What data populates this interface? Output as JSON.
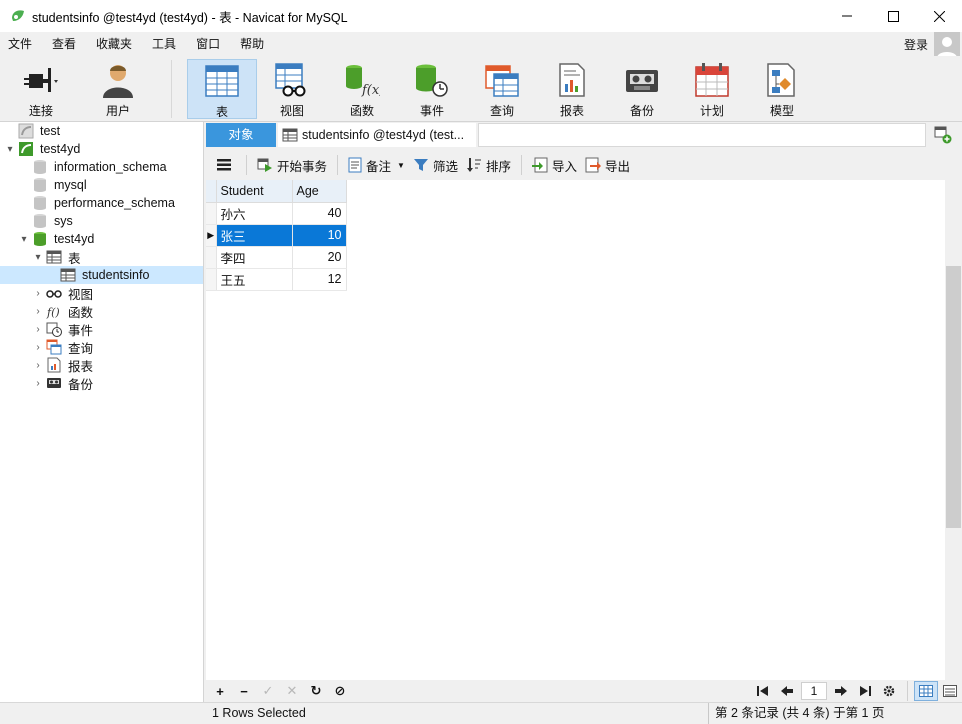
{
  "window": {
    "title": "studentsinfo @test4yd (test4yd) - 表 - Navicat for MySQL",
    "minimize": "minimize",
    "maximize": "maximize",
    "close": "close"
  },
  "menu": {
    "items": [
      "文件",
      "查看",
      "收藏夹",
      "工具",
      "窗口",
      "帮助"
    ],
    "login": "登录"
  },
  "toolbar": {
    "buttons": [
      {
        "label": "连接",
        "icon": "plug-icon"
      },
      {
        "label": "用户",
        "icon": "user-icon"
      },
      {
        "label": "表",
        "icon": "table-icon",
        "active": true
      },
      {
        "label": "视图",
        "icon": "view-icon"
      },
      {
        "label": "函数",
        "icon": "function-icon"
      },
      {
        "label": "事件",
        "icon": "event-icon"
      },
      {
        "label": "查询",
        "icon": "query-icon"
      },
      {
        "label": "报表",
        "icon": "report-icon"
      },
      {
        "label": "备份",
        "icon": "backup-icon"
      },
      {
        "label": "计划",
        "icon": "schedule-icon"
      },
      {
        "label": "模型",
        "icon": "model-icon"
      }
    ]
  },
  "sidebar": {
    "nodes": [
      {
        "label": "test",
        "icon": "connection-icon-inactive",
        "expanded": null
      },
      {
        "label": "test4yd",
        "icon": "connection-icon-active",
        "expanded": true
      },
      {
        "label": "information_schema",
        "icon": "database-icon-inactive"
      },
      {
        "label": "mysql",
        "icon": "database-icon-inactive"
      },
      {
        "label": "performance_schema",
        "icon": "database-icon-inactive"
      },
      {
        "label": "sys",
        "icon": "database-icon-inactive"
      },
      {
        "label": "test4yd",
        "icon": "database-icon-active",
        "expanded": true
      },
      {
        "label": "表",
        "icon": "table-icon",
        "expanded": true
      },
      {
        "label": "studentsinfo",
        "icon": "table-icon",
        "selected": true
      },
      {
        "label": "视图",
        "icon": "view-icon",
        "expanded": false
      },
      {
        "label": "函数",
        "icon": "function-icon",
        "expanded": false
      },
      {
        "label": "事件",
        "icon": "event-icon",
        "expanded": false
      },
      {
        "label": "查询",
        "icon": "query-icon",
        "expanded": false
      },
      {
        "label": "报表",
        "icon": "report-icon",
        "expanded": false
      },
      {
        "label": "备份",
        "icon": "backup-icon",
        "expanded": false
      }
    ]
  },
  "tabs": {
    "objects": "对象",
    "document": "studentsinfo @test4yd (test..."
  },
  "table_toolbar": {
    "menu_icon": "hamburger-icon",
    "begin_transaction": "开始事务",
    "memo": "备注",
    "filter": "筛选",
    "sort": "排序",
    "import": "导入",
    "export": "导出"
  },
  "grid": {
    "columns": [
      "Student",
      "Age"
    ],
    "rows": [
      {
        "Student": "孙六",
        "Age": "40"
      },
      {
        "Student": "张三",
        "Age": "10",
        "selected": true
      },
      {
        "Student": "李四",
        "Age": "20"
      },
      {
        "Student": "王五",
        "Age": "12"
      }
    ]
  },
  "navbar": {
    "page": "1",
    "add": "+",
    "remove": "−",
    "apply": "✓",
    "discard": "✕",
    "refresh": "↻",
    "stop": "⊘"
  },
  "status": {
    "left": "1 Rows Selected",
    "right": "第 2 条记录 (共 4 条) 于第 1 页"
  },
  "colors": {
    "selection": "#0a78d7",
    "tab_active": "#3a96dd",
    "tree_selected": "#cce8ff",
    "toolbar_active": "#cde3f7"
  }
}
